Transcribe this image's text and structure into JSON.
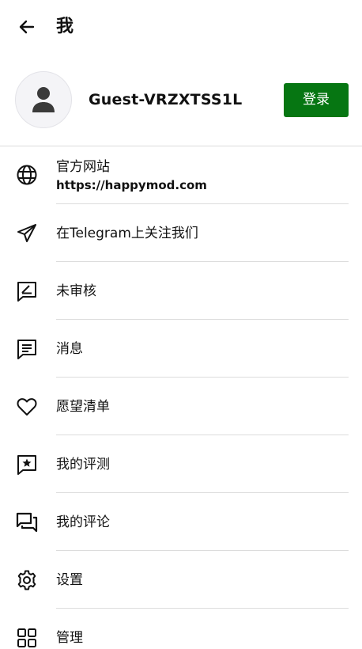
{
  "header": {
    "title": "我",
    "back_icon": "arrow-left-icon"
  },
  "profile": {
    "username": "Guest-VRZXTSS1L",
    "login_label": "登录",
    "login_color": "#067612",
    "avatar_icon": "person-icon"
  },
  "menu": {
    "items": [
      {
        "label": "官方网站",
        "sublabel": "https://happymod.com",
        "icon": "globe-icon"
      },
      {
        "label": "在Telegram上关注我们",
        "icon": "telegram-send-icon"
      },
      {
        "label": "未审核",
        "icon": "edit-box-icon"
      },
      {
        "label": "消息",
        "icon": "message-icon"
      },
      {
        "label": "愿望清单",
        "icon": "heart-icon"
      },
      {
        "label": "我的评测",
        "icon": "star-comment-icon"
      },
      {
        "label": "我的评论",
        "icon": "comments-icon"
      },
      {
        "label": "设置",
        "icon": "gear-icon"
      },
      {
        "label": "管理",
        "icon": "grid-icon"
      }
    ]
  }
}
